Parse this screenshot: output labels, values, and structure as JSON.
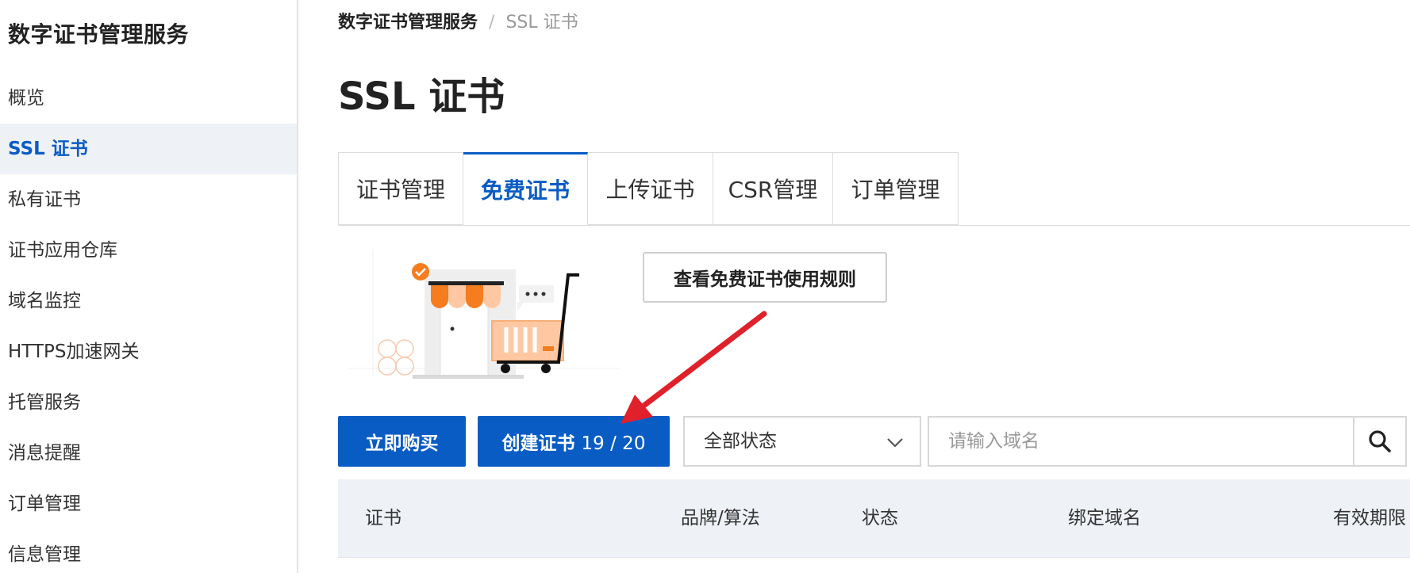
{
  "app": {
    "title": "数字证书管理服务"
  },
  "sidebar": {
    "items": [
      {
        "label": "概览",
        "active": false
      },
      {
        "label": "SSL 证书",
        "active": true
      },
      {
        "label": "私有证书",
        "active": false
      },
      {
        "label": "证书应用仓库",
        "active": false
      },
      {
        "label": "域名监控",
        "active": false
      },
      {
        "label": "HTTPS加速网关",
        "active": false
      },
      {
        "label": "托管服务",
        "active": false
      },
      {
        "label": "消息提醒",
        "active": false
      },
      {
        "label": "订单管理",
        "active": false
      },
      {
        "label": "信息管理",
        "active": false
      }
    ]
  },
  "breadcrumb": {
    "root": "数字证书管理服务",
    "separator": "/",
    "current": "SSL 证书"
  },
  "page": {
    "title": "SSL 证书"
  },
  "tabs": [
    {
      "label": "证书管理",
      "active": false
    },
    {
      "label": "免费证书",
      "active": true
    },
    {
      "label": "上传证书",
      "active": false
    },
    {
      "label": "CSR管理",
      "active": false
    },
    {
      "label": "订单管理",
      "active": false
    }
  ],
  "banner": {
    "illustration": "shop-cart-illustration",
    "rules_button": "查看免费证书使用规则"
  },
  "toolbar": {
    "buy_button": "立即购买",
    "create_button": "创建证书",
    "create_count": "19 / 20",
    "status_select": {
      "value": "全部状态"
    },
    "search": {
      "placeholder": "请输入域名",
      "value": ""
    }
  },
  "table": {
    "columns": [
      "证书",
      "品牌/算法",
      "状态",
      "绑定域名",
      "有效期限"
    ]
  },
  "colors": {
    "primary": "#0a5cc5",
    "sidebar_active_bg": "#eef1f6",
    "table_header_bg": "#eef1f6",
    "annotation_arrow": "#e0202a",
    "illustration_accent": "#f57c1f"
  },
  "icons": {
    "search": "search-icon",
    "chevron": "chevron-down-icon",
    "badge": "check-badge-icon",
    "annotation": "red-arrow-annotation"
  }
}
